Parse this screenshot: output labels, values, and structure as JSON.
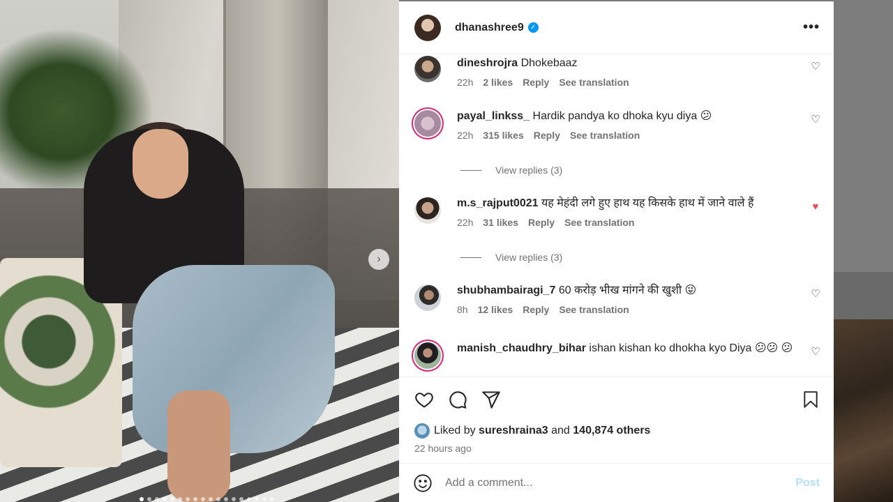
{
  "post": {
    "username": "dhanashree9",
    "more_icon": "more-horizontal-icon"
  },
  "comments": [
    {
      "user": "dineshrojra",
      "text": "Dhokebaaz",
      "time": "22h",
      "likes": "2 likes",
      "reply": "Reply",
      "translate": "See translation",
      "liked": false
    },
    {
      "user": "payal_linkss_",
      "text": "Hardik pandya ko dhoka kyu diya 😕",
      "time": "22h",
      "likes": "315 likes",
      "reply": "Reply",
      "translate": "See translation",
      "liked": false,
      "view_replies": "View replies (3)"
    },
    {
      "user": "m.s_rajput0021",
      "text": "यह मेहंदी लगे हुए हाथ यह किसके हाथ में जाने वाले हैं",
      "time": "22h",
      "likes": "31 likes",
      "reply": "Reply",
      "translate": "See translation",
      "liked": true,
      "view_replies": "View replies (3)"
    },
    {
      "user": "shubhambairagi_7",
      "text": "60 करोड़ भीख मांगने की खुशी 😜",
      "time": "8h",
      "likes": "12 likes",
      "reply": "Reply",
      "translate": "See translation",
      "liked": false
    },
    {
      "user": "manish_chaudhry_bihar",
      "text": "ishan kishan ko dhokha kyo Diya 😕😕 😕",
      "liked": false
    }
  ],
  "likes": {
    "prefix": "Liked by",
    "user": "sureshraina3",
    "and": "and",
    "others": "140,874 others"
  },
  "time_ago": "22 hours ago",
  "composer": {
    "placeholder": "Add a comment...",
    "post_label": "Post"
  },
  "colors": {
    "accent": "#0095f6",
    "liked_heart": "#ed4956",
    "post_disabled": "#b2dffc",
    "story_ring": "#d62976"
  }
}
